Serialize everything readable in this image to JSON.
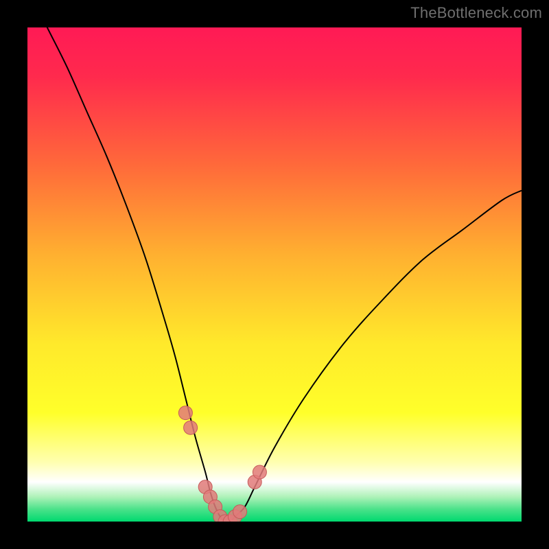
{
  "attribution": "TheBottleneck.com",
  "colors": {
    "black": "#000000",
    "curve": "#000000",
    "marker_fill": "#e27a7a",
    "marker_stroke": "#c55a5a",
    "gradient_stops": [
      {
        "offset": 0.0,
        "color": "#ff1a55"
      },
      {
        "offset": 0.1,
        "color": "#ff2a4d"
      },
      {
        "offset": 0.28,
        "color": "#ff6a3a"
      },
      {
        "offset": 0.46,
        "color": "#ffb030"
      },
      {
        "offset": 0.64,
        "color": "#ffe92b"
      },
      {
        "offset": 0.78,
        "color": "#ffff2a"
      },
      {
        "offset": 0.88,
        "color": "#ffffb0"
      },
      {
        "offset": 0.92,
        "color": "#ffffff"
      },
      {
        "offset": 0.95,
        "color": "#aef2b8"
      },
      {
        "offset": 0.975,
        "color": "#4be28a"
      },
      {
        "offset": 1.0,
        "color": "#00d96f"
      }
    ]
  },
  "chart_data": {
    "type": "line",
    "title": "",
    "xlabel": "",
    "ylabel": "",
    "xlim": [
      0,
      100
    ],
    "ylim": [
      0,
      100
    ],
    "series": [
      {
        "name": "bottleneck-curve",
        "x": [
          0,
          4,
          8,
          12,
          16,
          20,
          24,
          28,
          30,
          32,
          34,
          36,
          37,
          38,
          39,
          40,
          41,
          42,
          44,
          46,
          50,
          56,
          64,
          72,
          80,
          88,
          96,
          100
        ],
        "values": [
          108,
          100,
          92,
          83,
          74,
          64,
          53,
          40,
          33,
          25,
          17,
          10,
          6,
          3,
          1,
          0,
          0,
          1,
          3,
          7,
          15,
          25,
          36,
          45,
          53,
          59,
          65,
          67
        ]
      }
    ],
    "markers": {
      "name": "highlight-cluster",
      "x": [
        32,
        33,
        36,
        37,
        38,
        39,
        40,
        41,
        42,
        43,
        46,
        47
      ],
      "values": [
        22,
        19,
        7,
        5,
        3,
        1,
        0,
        0,
        1,
        2,
        8,
        10
      ],
      "r": 10
    }
  }
}
